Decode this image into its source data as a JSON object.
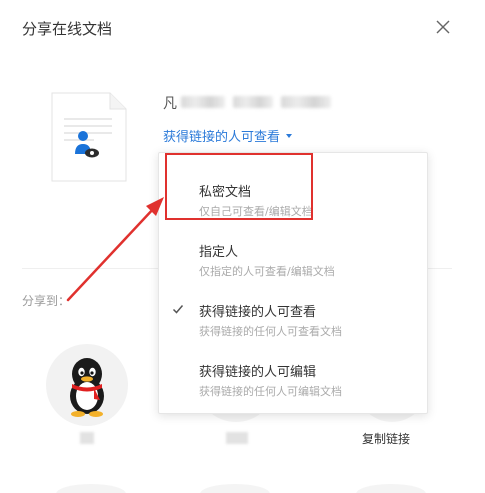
{
  "dialog": {
    "title": "分享在线文档",
    "close_icon": "close-icon"
  },
  "document": {
    "name_first_char": "凡",
    "permission_label": "获得链接的人可查看"
  },
  "share": {
    "label": "分享到：",
    "targets": [
      {
        "name": "QQ",
        "icon": "qq-penguin-icon"
      },
      {
        "name": "copy-link",
        "label": "复制链接"
      }
    ]
  },
  "dropdown": {
    "options": [
      {
        "title": "私密文档",
        "subtitle": "仅自己可查看/编辑文档",
        "checked": false
      },
      {
        "title": "指定人",
        "subtitle": "仅指定的人可查看/编辑文档",
        "checked": false
      },
      {
        "title": "获得链接的人可查看",
        "subtitle": "获得链接的任何人可查看文档",
        "checked": true
      },
      {
        "title": "获得链接的人可编辑",
        "subtitle": "获得链接的任何人可编辑文档",
        "checked": false
      }
    ]
  },
  "colors": {
    "accent": "#2b7ad9",
    "annotation_red": "#e0312e"
  }
}
